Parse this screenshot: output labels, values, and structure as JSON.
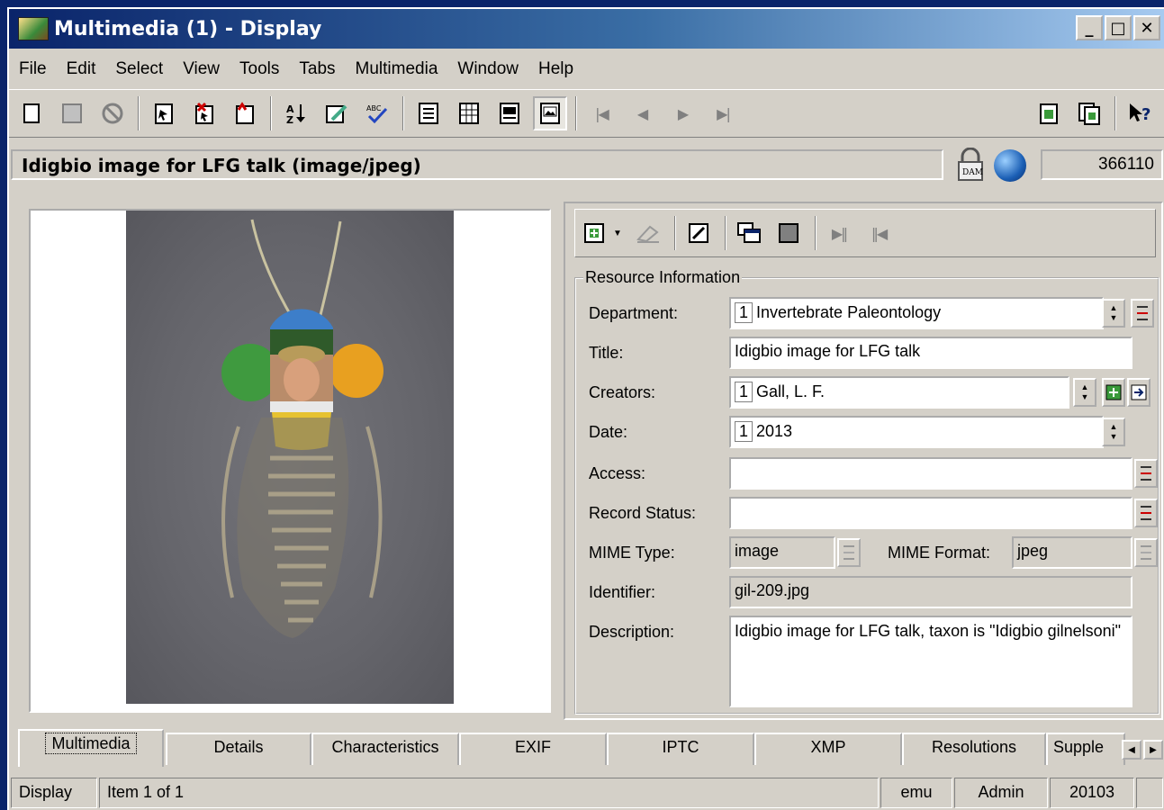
{
  "window": {
    "title": "Multimedia (1) - Display"
  },
  "menu": [
    "File",
    "Edit",
    "Select",
    "View",
    "Tools",
    "Tabs",
    "Multimedia",
    "Window",
    "Help"
  ],
  "record": {
    "title": "Idigbio image for LFG talk (image/jpeg)",
    "irn": "366110"
  },
  "resource": {
    "legend": "Resource Information",
    "department_label": "Department:",
    "department_seq": "1",
    "department_value": "Invertebrate Paleontology",
    "title_label": "Title:",
    "title_value": "Idigbio image for LFG talk",
    "creators_label": "Creators:",
    "creators_seq": "1",
    "creators_value": "Gall, L. F.",
    "date_label": "Date:",
    "date_seq": "1",
    "date_value": "2013",
    "access_label": "Access:",
    "access_value": "",
    "record_status_label": "Record Status:",
    "record_status_value": "",
    "mime_type_label": "MIME Type:",
    "mime_type_value": "image",
    "mime_format_label": "MIME Format:",
    "mime_format_value": "jpeg",
    "identifier_label": "Identifier:",
    "identifier_value": "gil-209.jpg",
    "description_label": "Description:",
    "description_value": "Idigbio image for LFG talk, taxon is \"Idigbio gilnelsoni\""
  },
  "tabs": [
    "Multimedia",
    "Details",
    "Characteristics",
    "EXIF",
    "IPTC",
    "XMP",
    "Resolutions",
    "Supple"
  ],
  "status": {
    "mode": "Display",
    "item": "Item 1 of 1",
    "db": "emu",
    "user": "Admin",
    "port": "20103"
  }
}
